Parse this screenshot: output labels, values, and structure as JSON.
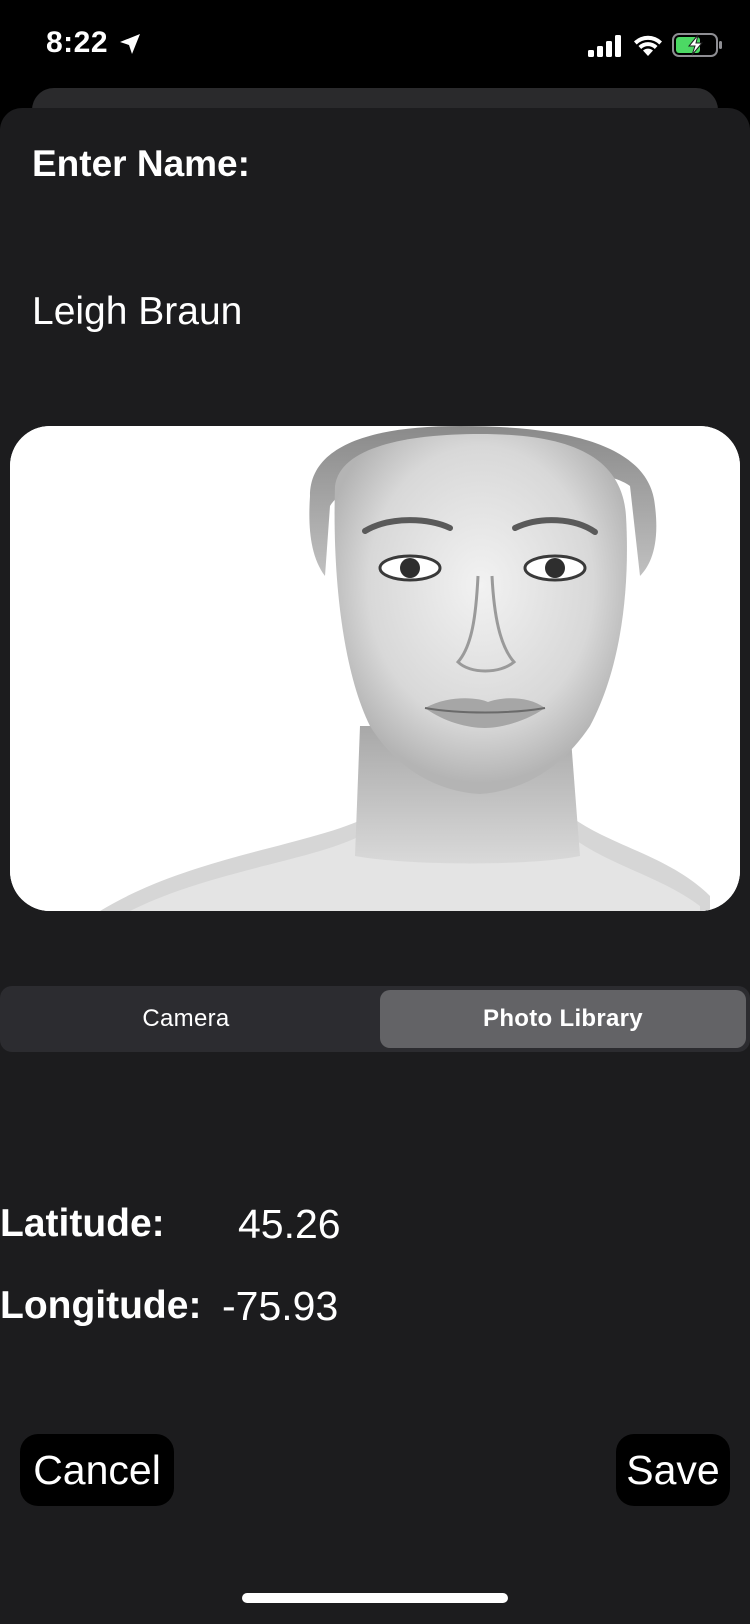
{
  "status_bar": {
    "time": "8:22",
    "icons": [
      "location-arrow-icon",
      "cellular-signal-icon",
      "wifi-icon",
      "battery-charging-icon"
    ],
    "battery_color": "#4cd964"
  },
  "form": {
    "name_label": "Enter Name:",
    "name_value": "Leigh Braun",
    "photo_description_icon": "portrait-photo"
  },
  "image_source": {
    "options": [
      "Camera",
      "Photo Library"
    ],
    "selected": "Photo Library"
  },
  "location": {
    "latitude_label": "Latitude:",
    "latitude_value": "45.26",
    "longitude_label": "Longitude:",
    "longitude_value": "-75.93"
  },
  "actions": {
    "cancel_label": "Cancel",
    "save_label": "Save"
  },
  "colors": {
    "sheet_background": "#1c1c1e",
    "segment_selected": "#636366",
    "segment_background": "#2c2c30"
  }
}
